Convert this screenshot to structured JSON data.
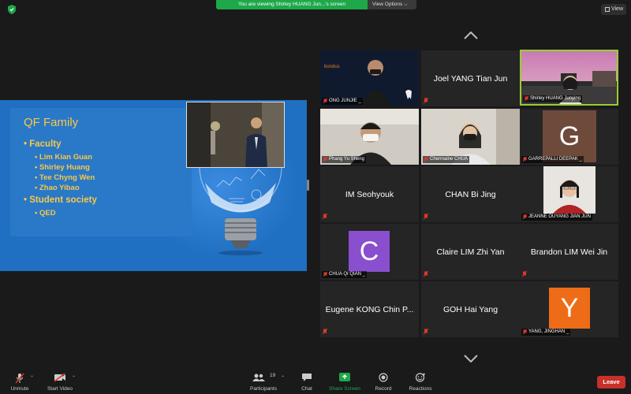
{
  "top": {
    "banner": "You are viewing Shirley HUANG Jun...'s screen",
    "view_options": "View Options",
    "view_button": "View"
  },
  "slide": {
    "title": "QF Family",
    "bullets": [
      {
        "level": 1,
        "text": "Faculty"
      },
      {
        "level": 2,
        "text": "Lim Kian Guan"
      },
      {
        "level": 2,
        "text": "Shirley Huang"
      },
      {
        "level": 2,
        "text": "Tee Chyng Wen"
      },
      {
        "level": 2,
        "text": "Zhao Yibao"
      },
      {
        "level": 1,
        "text": "Student society"
      },
      {
        "level": 2,
        "text": "QED"
      }
    ]
  },
  "gallery": {
    "tiles": [
      {
        "kind": "video",
        "label": "ONG JUNJIE _",
        "video_logo": "bondus"
      },
      {
        "kind": "name",
        "center_name": "Joel YANG Tian Jun"
      },
      {
        "kind": "video",
        "label": "Shirley HUANG Junying",
        "active": true
      },
      {
        "kind": "video",
        "label": "Phang Yu Sheng"
      },
      {
        "kind": "video",
        "label": "Chermaine CHUA"
      },
      {
        "kind": "avatar",
        "letter": "G",
        "avatar_color": "#6e4a3a",
        "label": "GARREPALLI DEEPAK _"
      },
      {
        "kind": "name",
        "center_name": "IM Seohyouk"
      },
      {
        "kind": "name",
        "center_name": "CHAN Bi Jing"
      },
      {
        "kind": "video",
        "label": "JEANNE OUYANG JIAN JUN"
      },
      {
        "kind": "avatar",
        "letter": "C",
        "avatar_color": "#8a4fcf",
        "label": "CHUA QI QIAN _"
      },
      {
        "kind": "name",
        "center_name": "Claire LIM Zhi Yan"
      },
      {
        "kind": "name",
        "center_name": "Brandon LIM Wei Jin"
      },
      {
        "kind": "name",
        "center_name": "Eugene KONG Chin P..."
      },
      {
        "kind": "name",
        "center_name": "GOH Hai Yang"
      },
      {
        "kind": "avatar",
        "letter": "Y",
        "avatar_color": "#ee6c17",
        "label": "YANG, JINGHAN _"
      }
    ]
  },
  "toolbar": {
    "unmute": "Unmute",
    "start_video": "Start Video",
    "participants": "Participants",
    "participant_count": "19",
    "chat": "Chat",
    "share_screen": "Share Screen",
    "record": "Record",
    "reactions": "Reactions",
    "leave": "Leave"
  },
  "colors": {
    "share_green": "#1ea84a",
    "leave_red": "#c8302c",
    "muted_red": "#e0362c",
    "active_speaker": "#9acd32",
    "slide_text": "#f7c948"
  }
}
